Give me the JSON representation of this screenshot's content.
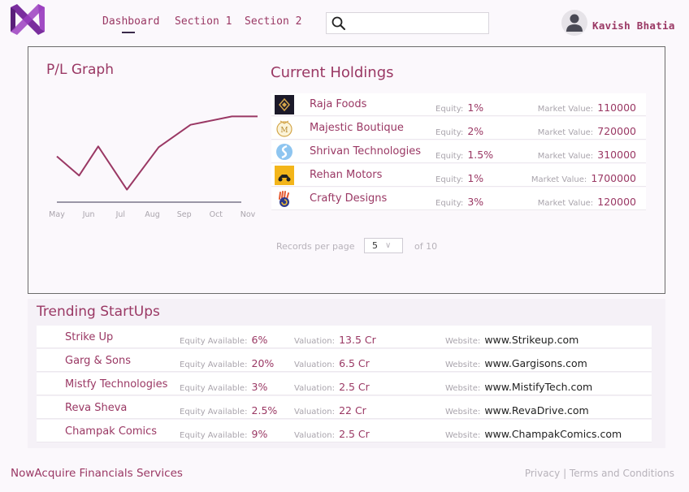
{
  "header": {
    "nav": [
      {
        "label": "Dashboard"
      },
      {
        "label": "Section 1"
      },
      {
        "label": "Section 2"
      }
    ],
    "search": {
      "placeholder": ""
    },
    "user": {
      "name": "Kavish Bhatia"
    }
  },
  "pl_graph": {
    "title": "P/L Graph"
  },
  "chart_data": {
    "type": "line",
    "title": "P/L Graph",
    "categories": [
      "May",
      "Jun",
      "Jul",
      "Aug",
      "Sep",
      "Oct",
      "Nov"
    ],
    "x_tick_labels": [
      "May",
      "Jun",
      "Jul",
      "Aug",
      "Sep",
      "Oct",
      "Nov"
    ],
    "series": [
      {
        "color": "#9a3864",
        "points": [
          {
            "x": 0.0,
            "y": 55
          },
          {
            "x": 0.7,
            "y": 32
          },
          {
            "x": 1.3,
            "y": 67
          },
          {
            "x": 2.2,
            "y": 15
          },
          {
            "x": 3.2,
            "y": 66
          },
          {
            "x": 4.2,
            "y": 93
          },
          {
            "x": 5.5,
            "y": 103
          },
          {
            "x": 6.7,
            "y": 103
          }
        ]
      }
    ],
    "ylim": [
      0,
      120
    ],
    "grid": false,
    "xlabel": "",
    "ylabel": ""
  },
  "holdings": {
    "title": "Current Holdings",
    "equity_label": "Equity:",
    "market_value_label": "Market Value:",
    "rows": [
      {
        "name": "Raja Foods",
        "equity": "1%",
        "market_value": "110000",
        "logo_icon": "diamond-crown-icon"
      },
      {
        "name": "Majestic Boutique",
        "equity": "2%",
        "market_value": "720000",
        "logo_icon": "m-crest-icon"
      },
      {
        "name": "Shrivan Technologies",
        "equity": "1.5%",
        "market_value": "310000",
        "logo_icon": "blue-swirl-icon"
      },
      {
        "name": "Rehan Motors",
        "equity": "1%",
        "market_value": "1700000",
        "logo_icon": "scooter-icon"
      },
      {
        "name": "Crafty Designs",
        "equity": "3%",
        "market_value": "120000",
        "logo_icon": "hand-swirl-icon"
      }
    ],
    "pagination": {
      "records_label": "Records per page",
      "per_page": "5",
      "of_label": "of 10"
    }
  },
  "trending": {
    "title": "Trending StartUps",
    "equity_label": "Equity Available:",
    "valuation_label": "Valuation:",
    "website_label": "Website:",
    "rows": [
      {
        "name": "Strike Up",
        "equity": "6%",
        "valuation": "13.5 Cr",
        "website": "www.Strikeup.com"
      },
      {
        "name": "Garg & Sons",
        "equity": "20%",
        "valuation": "6.5 Cr",
        "website": "www.Gargisons.com"
      },
      {
        "name": "Mistfy Technologies",
        "equity": "3%",
        "valuation": "2.5 Cr",
        "website": "www.MistifyTech.com"
      },
      {
        "name": "Reva Sheva",
        "equity": "2.5%",
        "valuation": "22 Cr",
        "website": "www.RevaDrive.com"
      },
      {
        "name": "Champak Comics",
        "equity": "9%",
        "valuation": "2.5 Cr",
        "website": "www.ChampakComics.com"
      }
    ]
  },
  "footer": {
    "brand": "NowAcquire Financials Services",
    "links": "Privacy | Terms and Conditions"
  },
  "colors": {
    "accent": "#9a3864",
    "logo_purple": "#7a2e9e",
    "background": "#fbf8fc"
  }
}
